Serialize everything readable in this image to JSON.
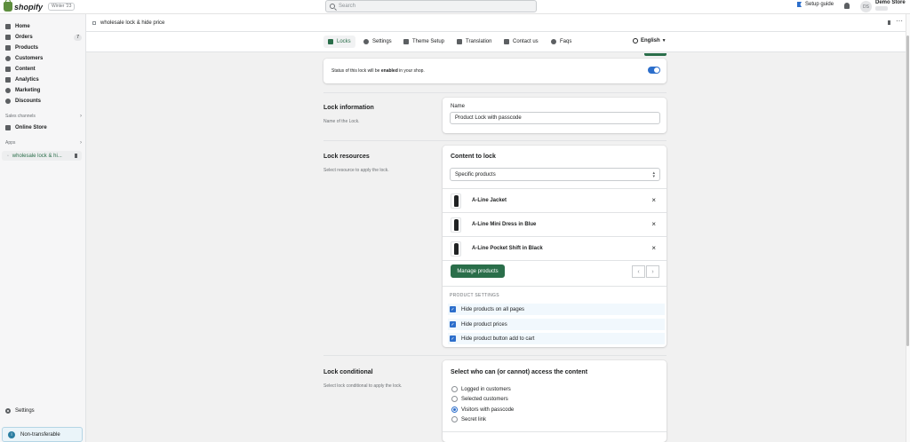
{
  "topbar": {
    "logo_text": "shopify",
    "version_badge": "Winter '23",
    "search_placeholder": "Search",
    "setup_guide": "Setup guide",
    "avatar_initials": "DS",
    "store_name": "Demo Store"
  },
  "sidebar": {
    "items": [
      {
        "label": "Home"
      },
      {
        "label": "Orders",
        "badge": "7"
      },
      {
        "label": "Products"
      },
      {
        "label": "Customers"
      },
      {
        "label": "Content"
      },
      {
        "label": "Analytics"
      },
      {
        "label": "Marketing"
      },
      {
        "label": "Discounts"
      }
    ],
    "sales_channels_title": "Sales channels",
    "online_store": "Online Store",
    "apps_title": "Apps",
    "app_item": "wholesale lock & hi...",
    "settings": "Settings",
    "non_transferable": "Non-transferable"
  },
  "app_header": {
    "title": "wholesale lock & hide price"
  },
  "tabs": [
    {
      "label": "Locks",
      "active": true
    },
    {
      "label": "Settings"
    },
    {
      "label": "Theme Setup"
    },
    {
      "label": "Translation"
    },
    {
      "label": "Contact us"
    },
    {
      "label": "Faqs"
    }
  ],
  "language": "English",
  "status": {
    "text_pre": "Status of this lock will be ",
    "text_bold": "enabled",
    "text_post": " in your shop.",
    "toggle_on": true
  },
  "lock_information": {
    "title": "Lock information",
    "desc": "Name of the Lock.",
    "name_label": "Name",
    "name_value": "Product Lock with passcode"
  },
  "lock_resources": {
    "title": "Lock resources",
    "desc": "Select resource to apply the lock.",
    "card_title": "Content to lock",
    "select_value": "Specific products",
    "products": [
      {
        "name": "A-Line Jacket"
      },
      {
        "name": "A-Line Mini Dress in Blue"
      },
      {
        "name": "A-Line Pocket Shift in Black"
      }
    ],
    "manage_button": "Manage products",
    "product_settings_title": "PRODUCT SETTINGS",
    "settings": [
      {
        "label": "Hide products on all pages",
        "checked": true
      },
      {
        "label": "Hide product prices",
        "checked": true
      },
      {
        "label": "Hide product button add to cart",
        "checked": true
      }
    ]
  },
  "lock_conditional": {
    "title": "Lock conditional",
    "desc": "Select lock conditional to apply the lock.",
    "card_title": "Select who can (or cannot) access the content",
    "options": [
      {
        "label": "Logged in customers",
        "selected": false
      },
      {
        "label": "Selected customers",
        "selected": false
      },
      {
        "label": "Visitors with passcode",
        "selected": true
      },
      {
        "label": "Secret link",
        "selected": false
      }
    ]
  },
  "colors": {
    "accent_green": "#2a6e4a",
    "toggle_blue": "#2c6ecb"
  }
}
